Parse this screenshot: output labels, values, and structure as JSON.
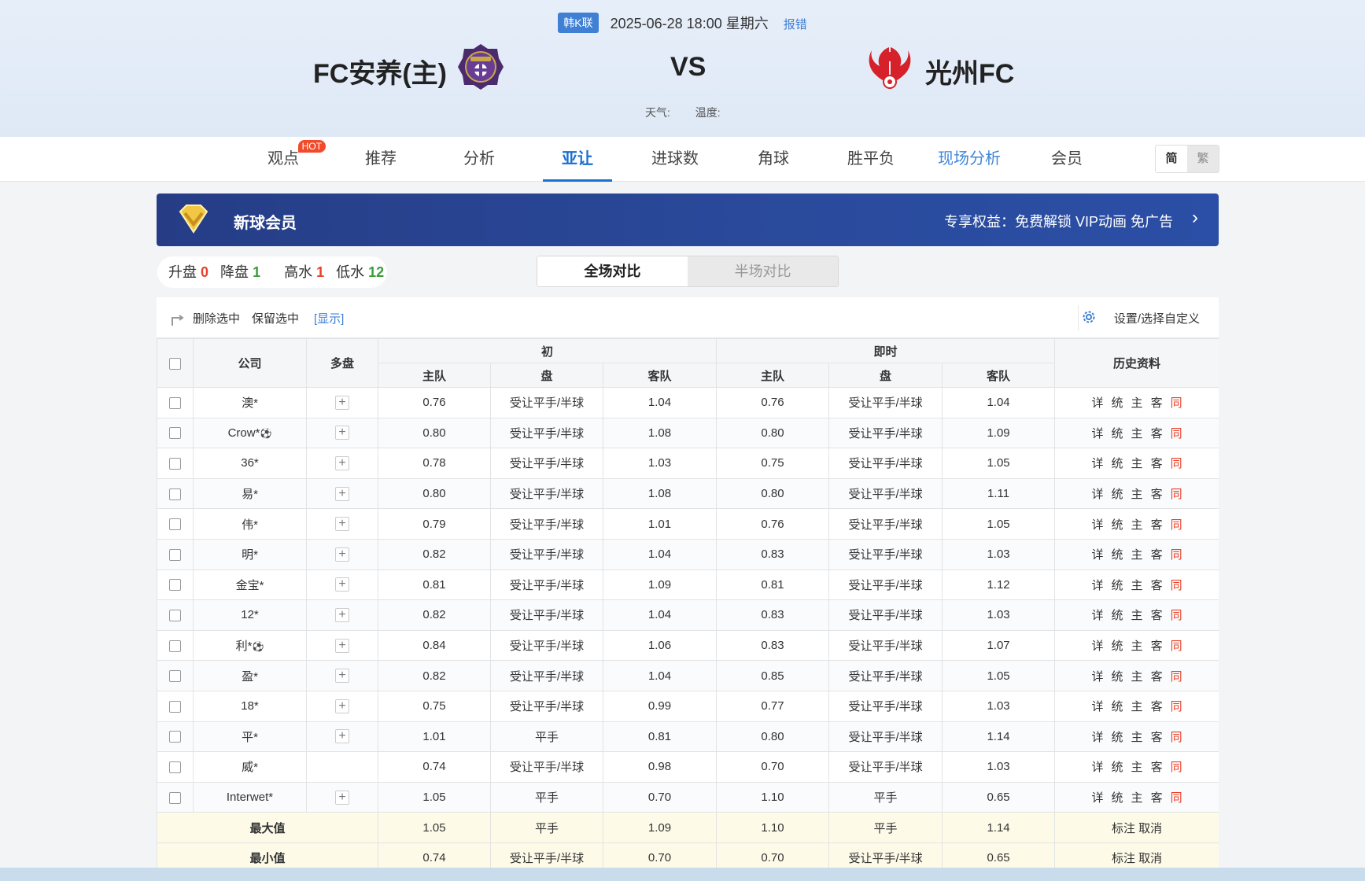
{
  "match": {
    "league": "韩K联",
    "datetime": "2025-06-28 18:00 星期六",
    "report": "报错",
    "home_team": "FC安养(主)",
    "away_team": "光州FC",
    "vs": "VS",
    "weather_label": "天气:",
    "temperature_label": "温度:"
  },
  "nav": {
    "items": [
      "观点",
      "推荐",
      "分析",
      "亚让",
      "进球数",
      "角球",
      "胜平负",
      "现场分析",
      "会员"
    ],
    "active": "亚让",
    "hot_badge": "HOT",
    "lang_simplified": "简",
    "lang_traditional": "繁"
  },
  "vip": {
    "title": "新球会员",
    "desc": "专享权益：免费解锁 VIP动画 免广告",
    "arrow": "›"
  },
  "summary": {
    "up_label": "升盘",
    "up_value": "0",
    "down_label": "降盘",
    "down_value": "1",
    "high_label": "高水",
    "high_value": "1",
    "low_label": "低水",
    "low_value": "12"
  },
  "toggle": {
    "full": "全场对比",
    "half": "半场对比"
  },
  "toolbar": {
    "delete": "删除选中",
    "keep": "保留选中",
    "show": "[显示]",
    "settings": "设置/选择自定义"
  },
  "table": {
    "headers": {
      "company": "公司",
      "multi": "多盘",
      "initial": "初",
      "live": "即时",
      "history": "历史资料",
      "home": "主队",
      "line": "盘",
      "away": "客队"
    },
    "history_links": {
      "detail": "详",
      "stats": "统",
      "home": "主",
      "away": "客",
      "same": "同"
    },
    "rows": [
      {
        "company": "澳*",
        "ball": false,
        "plus": true,
        "ih": "0.76",
        "il": "受让平手/半球",
        "ia": "1.04",
        "lh": "0.76",
        "ll": "受让平手/半球",
        "la": "1.04"
      },
      {
        "company": "Crow*",
        "ball": true,
        "plus": true,
        "ih": "0.80",
        "il": "受让平手/半球",
        "ia": "1.08",
        "lh": "0.80",
        "ll": "受让平手/半球",
        "la": "1.09"
      },
      {
        "company": "36*",
        "ball": false,
        "plus": true,
        "ih": "0.78",
        "il": "受让平手/半球",
        "ia": "1.03",
        "lh": "0.75",
        "ll": "受让平手/半球",
        "la": "1.05"
      },
      {
        "company": "易*",
        "ball": false,
        "plus": true,
        "ih": "0.80",
        "il": "受让平手/半球",
        "ia": "1.08",
        "lh": "0.80",
        "ll": "受让平手/半球",
        "la": "1.11"
      },
      {
        "company": "伟*",
        "ball": false,
        "plus": true,
        "ih": "0.79",
        "il": "受让平手/半球",
        "ia": "1.01",
        "lh": "0.76",
        "ll": "受让平手/半球",
        "la": "1.05"
      },
      {
        "company": "明*",
        "ball": false,
        "plus": true,
        "ih": "0.82",
        "il": "受让平手/半球",
        "ia": "1.04",
        "lh": "0.83",
        "ll": "受让平手/半球",
        "la": "1.03"
      },
      {
        "company": "金宝*",
        "ball": false,
        "plus": true,
        "ih": "0.81",
        "il": "受让平手/半球",
        "ia": "1.09",
        "lh": "0.81",
        "ll": "受让平手/半球",
        "la": "1.12"
      },
      {
        "company": "12*",
        "ball": false,
        "plus": true,
        "ih": "0.82",
        "il": "受让平手/半球",
        "ia": "1.04",
        "lh": "0.83",
        "ll": "受让平手/半球",
        "la": "1.03"
      },
      {
        "company": "利*",
        "ball": true,
        "plus": true,
        "ih": "0.84",
        "il": "受让平手/半球",
        "ia": "1.06",
        "lh": "0.83",
        "ll": "受让平手/半球",
        "la": "1.07"
      },
      {
        "company": "盈*",
        "ball": false,
        "plus": true,
        "ih": "0.82",
        "il": "受让平手/半球",
        "ia": "1.04",
        "lh": "0.85",
        "ll": "受让平手/半球",
        "la": "1.05"
      },
      {
        "company": "18*",
        "ball": false,
        "plus": true,
        "ih": "0.75",
        "il": "受让平手/半球",
        "ia": "0.99",
        "lh": "0.77",
        "ll": "受让平手/半球",
        "la": "1.03"
      },
      {
        "company": "平*",
        "ball": false,
        "plus": true,
        "ih": "1.01",
        "il": "平手",
        "ia": "0.81",
        "lh": "0.80",
        "ll": "受让平手/半球",
        "la": "1.14"
      },
      {
        "company": "威*",
        "ball": false,
        "plus": false,
        "ih": "0.74",
        "il": "受让平手/半球",
        "ia": "0.98",
        "lh": "0.70",
        "ll": "受让平手/半球",
        "la": "1.03"
      },
      {
        "company": "Interwet*",
        "ball": false,
        "plus": true,
        "ih": "1.05",
        "il": "平手",
        "ia": "0.70",
        "lh": "1.10",
        "ll": "平手",
        "la": "0.65"
      }
    ],
    "stats": [
      {
        "label": "最大值",
        "ih": "1.05",
        "il": "平手",
        "ia": "1.09",
        "lh": "1.10",
        "ll": "平手",
        "la": "1.14",
        "actions": "标注 取消"
      },
      {
        "label": "最小值",
        "ih": "0.74",
        "il": "受让平手/半球",
        "ia": "0.70",
        "lh": "0.70",
        "ll": "受让平手/半球",
        "la": "0.65",
        "actions": "标注 取消"
      }
    ]
  }
}
